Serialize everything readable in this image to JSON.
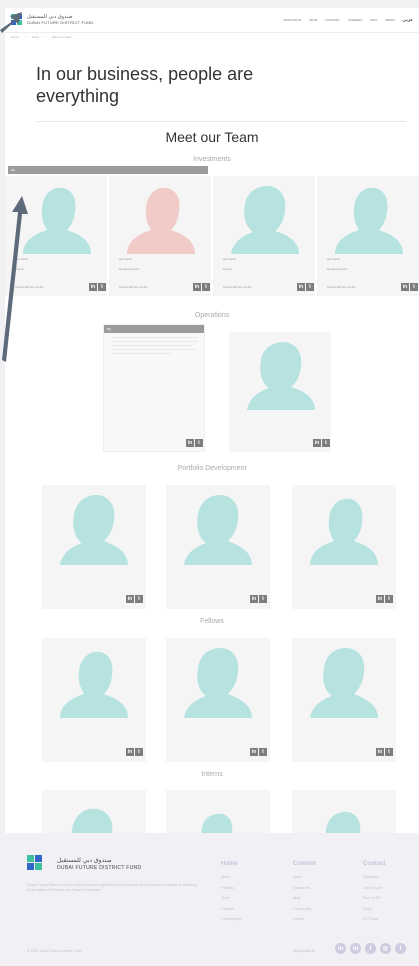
{
  "header": {
    "logo_ar": "صندوق دبي للمستقبل",
    "logo_en": "DUBAI FUTURE DISTRICT FUND",
    "nav": [
      "PORTFOLIO",
      "TEAM",
      "CONTENT",
      "CAREERS",
      "INFO",
      "MEDIA"
    ],
    "language": "عربي"
  },
  "breadcrumb": [
    "Home",
    "Team",
    "Meet our Team"
  ],
  "hero": {
    "title": "In our business, people are everything"
  },
  "team": {
    "title": "Meet our Team",
    "groups": {
      "investments": "Investments",
      "operations": "Operations",
      "portfolio": "Portfolio Development",
      "fellows": "Fellows",
      "interns": "Interns"
    },
    "investments_members": [
      {
        "name": "Jane Smith",
        "role": "Director",
        "meta": "Connect with this member"
      },
      {
        "name": "Jane Smith",
        "role": "Managing Director",
        "meta": "Connect with this member"
      },
      {
        "name": "Jane Smith",
        "role": "Director",
        "meta": "Connect with this member"
      },
      {
        "name": "Jane Smith",
        "role": "Managing Director",
        "meta": "Connect with this member"
      }
    ],
    "tooltip_top": "Bio",
    "tooltip_ops": "Bio"
  },
  "colors": {
    "teal": "#b6e3e0",
    "pink": "#f1cbc8",
    "card": "#f5f5f5",
    "accent_green": "#3fbf9e",
    "accent_blue": "#2f66c7"
  },
  "footer": {
    "logo_ar": "صندوق دبي للمستقبل",
    "logo_en": "DUBAI FUTURE DISTRICT FUND",
    "description": "Dubai Future District Fund is Dubai's venture capital fund of funds and direct investment platform, investing in the future of Finance and Future Economies.",
    "columns": [
      {
        "heading": "Home",
        "items": [
          "About",
          "Portfolio",
          "Team",
          "Careers",
          "Partnerships"
        ]
      },
      {
        "heading": "Content",
        "items": [
          "News",
          "Resources",
          "Blog",
          "Community",
          "Events"
        ]
      },
      {
        "heading": "Contact",
        "items": [
          "Subscribe",
          "Get in touch",
          "Pitch to DF",
          "FAQs",
          "DF Portal"
        ]
      }
    ],
    "copyright": "© 2022 Dubai Future District Fund",
    "email": "hello@dfdf.ae",
    "social_icons": [
      "linkedin-icon",
      "linkedin-icon",
      "facebook-icon",
      "instagram-icon",
      "twitter-icon"
    ]
  }
}
